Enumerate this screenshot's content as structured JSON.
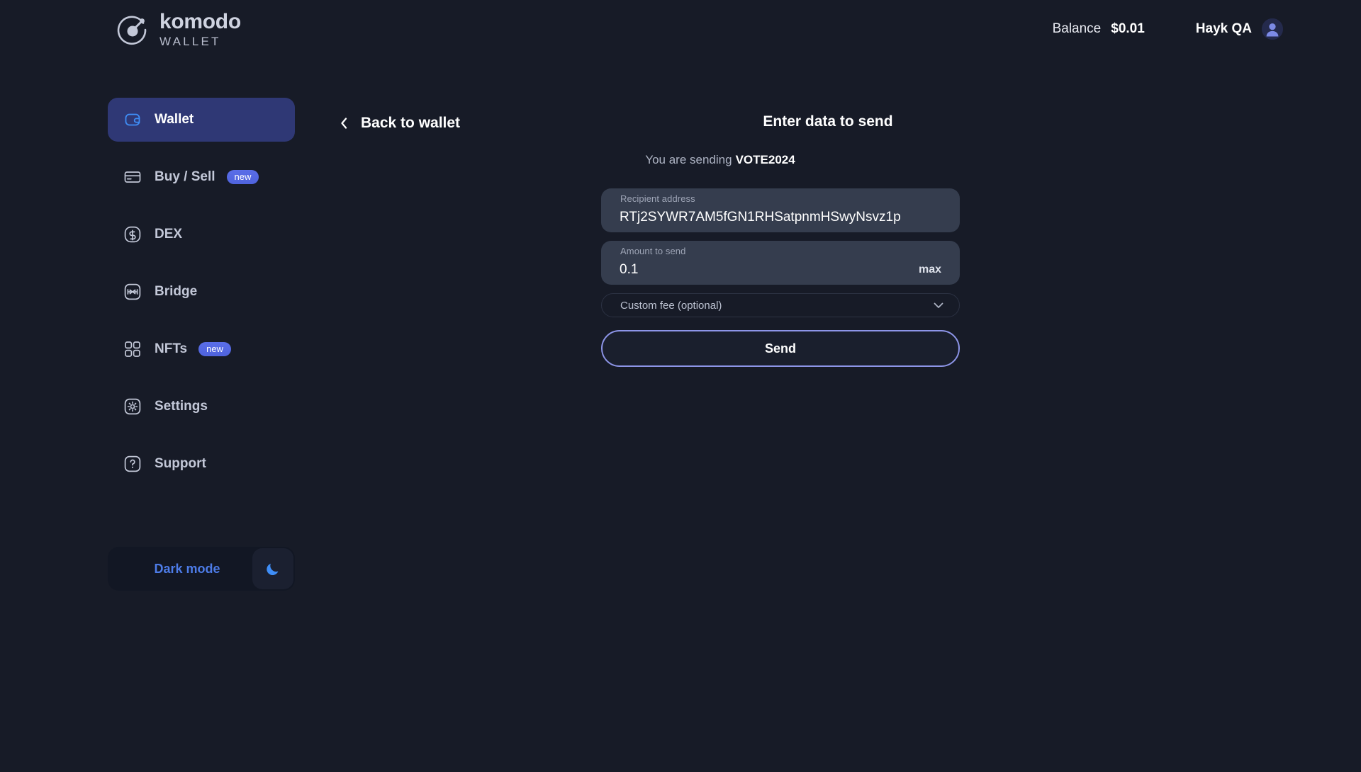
{
  "brand": {
    "name": "komodo",
    "sub": "WALLET",
    "logo_icon": "komodo-logo-icon"
  },
  "header": {
    "balance_label": "Balance",
    "balance_value": "$0.01",
    "user_name": "Hayk QA",
    "avatar_icon": "user-avatar-icon"
  },
  "sidebar": {
    "items": [
      {
        "label": "Wallet",
        "icon": "wallet-icon",
        "active": true,
        "badge": ""
      },
      {
        "label": "Buy / Sell",
        "icon": "card-icon",
        "active": false,
        "badge": "new"
      },
      {
        "label": "DEX",
        "icon": "swap-icon",
        "active": false,
        "badge": ""
      },
      {
        "label": "Bridge",
        "icon": "bridge-icon",
        "active": false,
        "badge": ""
      },
      {
        "label": "NFTs",
        "icon": "grid-icon",
        "active": false,
        "badge": "new"
      },
      {
        "label": "Settings",
        "icon": "gear-icon",
        "active": false,
        "badge": ""
      },
      {
        "label": "Support",
        "icon": "question-icon",
        "active": false,
        "badge": ""
      }
    ],
    "theme_toggle": {
      "label": "Dark mode",
      "icon": "moon-icon"
    }
  },
  "main": {
    "back_label": "Back to wallet",
    "back_icon": "chevron-left-icon",
    "title": "Enter data to send",
    "sending_prefix": "You are sending",
    "sending_ticker": "VOTE2024",
    "fields": {
      "recipient": {
        "label": "Recipient address",
        "value": "RTj2SYWR7AM5fGN1RHSatpnmHSwyNsvz1p",
        "placeholder": "Recipient address"
      },
      "amount": {
        "label": "Amount to send",
        "value": "0.1",
        "placeholder": "0",
        "max_label": "max"
      },
      "custom_fee": {
        "label": "Custom fee (optional)",
        "caret_icon": "chevron-down-icon"
      }
    },
    "send_label": "Send"
  },
  "colors": {
    "background": "#171b27",
    "sidebar_active": "#2f3875",
    "field_bg": "#353d4e",
    "accent_blue": "#4d7ce8",
    "badge_blue": "#5a6ee8",
    "send_border": "#8d95e8",
    "text_primary": "#ffffff",
    "text_muted": "#aeb4c4"
  }
}
